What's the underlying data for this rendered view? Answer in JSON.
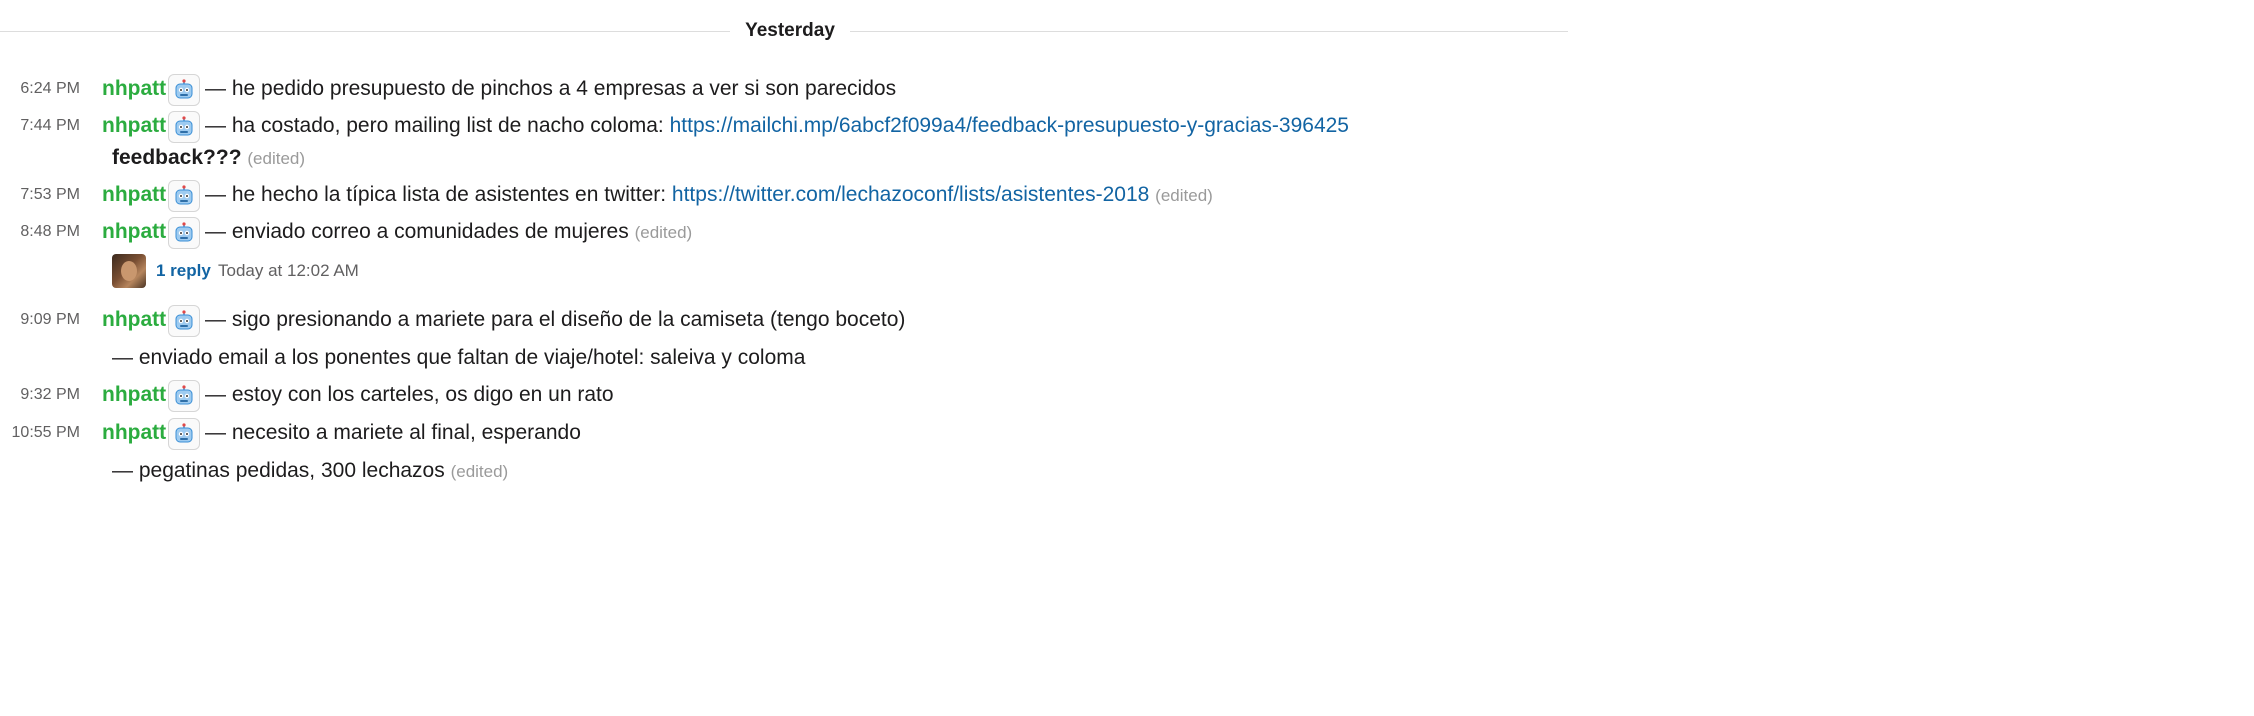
{
  "day_divider": "Yesterday",
  "messages": [
    {
      "time": "6:24 PM",
      "user": "nhpatt",
      "text": "— he pedido presupuesto de pinchos a 4 empresas a ver si son parecidos"
    },
    {
      "time": "7:44 PM",
      "user": "nhpatt",
      "text": "— ha costado, pero mailing list de nacho coloma: ",
      "link": "https://mailchi.mp/6abcf2f099a4/feedback-presupuesto-y-gracias-396425",
      "cont_bold": "feedback???",
      "edited": "(edited)"
    },
    {
      "time": "7:53 PM",
      "user": "nhpatt",
      "text": "— he hecho la típica lista de asistentes en twitter: ",
      "link": "https://twitter.com/lechazoconf/lists/asistentes-2018",
      "edited": "(edited)"
    },
    {
      "time": "8:48 PM",
      "user": "nhpatt",
      "text": "— enviado correo a comunidades de mujeres",
      "edited": "(edited)"
    },
    {
      "time": "9:09 PM",
      "user": "nhpatt",
      "text": "— sigo presionando a mariete para el diseño de la camiseta (tengo boceto)",
      "cont": "— enviado email a los ponentes que faltan de viaje/hotel: saleiva y coloma"
    },
    {
      "time": "9:32 PM",
      "user": "nhpatt",
      "text": "— estoy con los carteles, os digo en un rato"
    },
    {
      "time": "10:55 PM",
      "user": "nhpatt",
      "text": "— necesito a mariete al final, esperando",
      "cont": "— pegatinas pedidas, 300 lechazos",
      "edited": "(edited)"
    }
  ],
  "thread": {
    "reply_count": "1 reply",
    "last_reply": "Today at 12:02 AM"
  },
  "colors": {
    "username": "#2bac3f",
    "link": "#1264a3",
    "edited": "#9a9a9a",
    "time": "#616061"
  },
  "icons": {
    "bot_badge": "robot-face-icon"
  }
}
